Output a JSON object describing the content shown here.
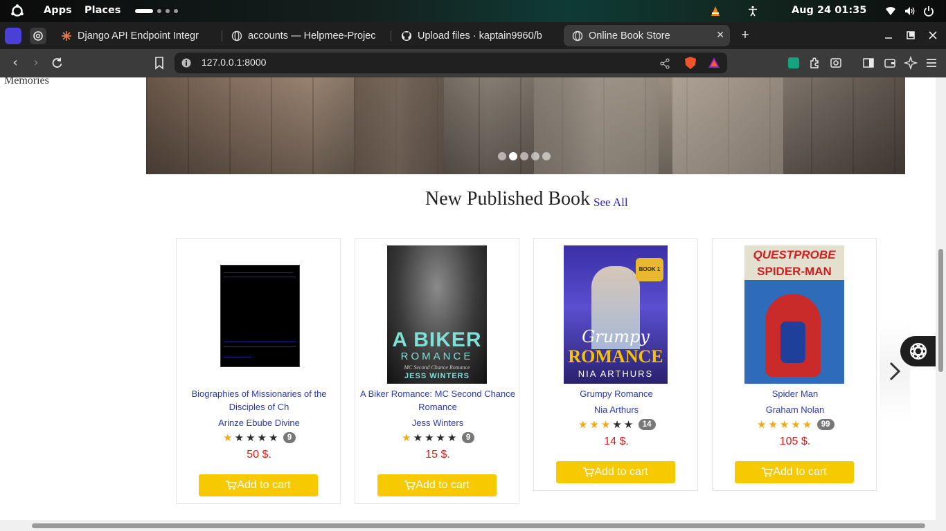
{
  "system_bar": {
    "apps": "Apps",
    "places": "Places",
    "clock": "Aug 24  01:35"
  },
  "browser": {
    "tabs": [
      {
        "label": "Django API Endpoint Integr"
      },
      {
        "label": "accounts — Helpmee-Projec"
      },
      {
        "label": "Upload files · kaptain9960/b"
      },
      {
        "label": "Online Book Store"
      }
    ],
    "new_tab": "+",
    "url": "127.0.0.1:8000"
  },
  "page": {
    "side_text": "Memories",
    "section_title": "New Published Book",
    "see_all": "See All",
    "books": [
      {
        "title": "Biographies of Missionaries of the Disciples of Ch",
        "author": "Arinze Ebube Divine",
        "rating": 1,
        "reviews": "9",
        "price": "50 $.",
        "button": "Add to cart"
      },
      {
        "title": "A Biker Romance: MC Second Chance Romance",
        "author": "Jess Winters",
        "rating": 1,
        "reviews": "9",
        "price": "15 $.",
        "button": "Add to cart",
        "cover_line1": "A BIKER",
        "cover_line2": "ROMANCE",
        "cover_sub": "MC Second Chance Romance",
        "cover_author": "JESS WINTERS"
      },
      {
        "title": "Grumpy Romance",
        "author": "Nia Arthurs",
        "rating": 3,
        "reviews": "14",
        "price": "14 $.",
        "button": "Add to cart",
        "cover_line1": "Grumpy",
        "cover_line2": "ROMANCE",
        "cover_author": "NIA ARTHURS",
        "cover_badge": "BOOK 1"
      },
      {
        "title": "Spider Man",
        "author": "Graham Nolan",
        "rating": 5,
        "reviews": "99",
        "price": "105 $.",
        "button": "Add to cart",
        "cover_line1": "QUESTPROBE",
        "cover_line2": "SPIDER-MAN"
      }
    ]
  },
  "colors": {
    "link": "#2d3bb3",
    "price": "#d41e1e",
    "cart_button": "#f7c900",
    "star_on": "#f2a916"
  }
}
